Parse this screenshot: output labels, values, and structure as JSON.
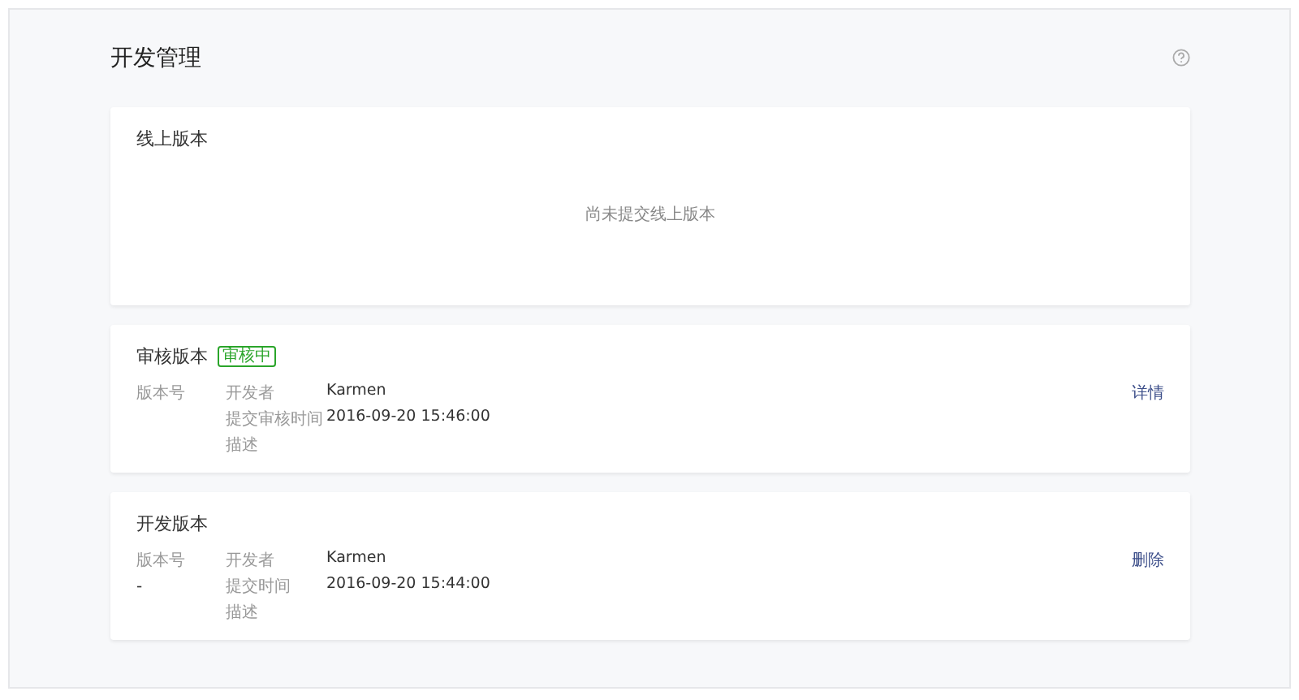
{
  "page": {
    "title": "开发管理"
  },
  "sections": [
    {
      "kind": "empty",
      "title": "线上版本",
      "message": "尚未提交线上版本"
    },
    {
      "kind": "info",
      "title": "审核版本",
      "badge": "审核中",
      "version_label": "版本号",
      "fields": [
        {
          "label": "开发者",
          "value": "Karmen"
        },
        {
          "label": "提交审核时间",
          "value": "2016-09-20 15:46:00"
        },
        {
          "label": "描述"
        }
      ],
      "action": "详情"
    },
    {
      "kind": "info",
      "title": "开发版本",
      "version_label": "版本号",
      "version": "-",
      "fields": [
        {
          "label": "开发者",
          "value": "Karmen"
        },
        {
          "label": "提交时间",
          "value": "2016-09-20 15:44:00"
        },
        {
          "label": "描述"
        }
      ],
      "action": "删除"
    }
  ]
}
